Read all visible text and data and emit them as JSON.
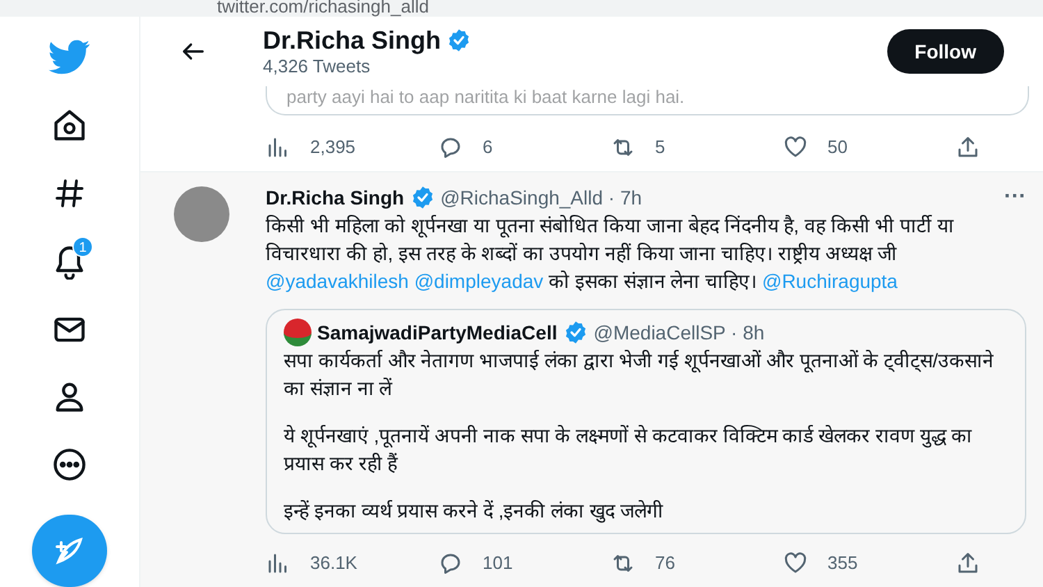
{
  "browser": {
    "url": "twitter.com/richasingh_alld"
  },
  "sidebar": {
    "items": [
      {
        "kind": "logo"
      },
      {
        "kind": "home"
      },
      {
        "kind": "explore"
      },
      {
        "kind": "notifications",
        "badge": "1"
      },
      {
        "kind": "messages"
      },
      {
        "kind": "profile"
      },
      {
        "kind": "more"
      }
    ],
    "compose": true
  },
  "header": {
    "name": "Dr.Richa Singh",
    "verified": true,
    "tweet_count": "4,326 Tweets",
    "follow_button": "Follow"
  },
  "previous_tweet": {
    "quoted_text": "party aayi hai to aap naritita ki baat karne lagi hai.",
    "stats": [
      {
        "kind": "views",
        "count": "2,395"
      },
      {
        "kind": "reply",
        "count": "6"
      },
      {
        "kind": "retweet",
        "count": "5"
      },
      {
        "kind": "like",
        "count": "50"
      },
      {
        "kind": "share"
      }
    ]
  },
  "tweet": {
    "author": "Dr.Richa Singh",
    "verified": true,
    "handle": "@RichaSingh_Alld · 7h",
    "menu": "···",
    "body": [
      {
        "kind": "text",
        "text": "किसी भी महिला को शूर्पनखा या पूतना संबोधित किया जाना बेहद निंदनीय है, वह किसी भी पार्टी या विचारधारा की हो, इस तरह के शब्दों का उपयोग नहीं किया जाना चाहिए। राष्ट्रीय अध्यक्ष जी "
      },
      {
        "kind": "mention",
        "text": "@yadavakhilesh"
      },
      {
        "kind": "mention",
        "text": "@dimpleyadav"
      },
      {
        "kind": "text",
        "text": " को इसका संज्ञान लेना चाहिए। "
      },
      {
        "kind": "mention",
        "text": "@Ruchiragupta"
      }
    ],
    "quote": {
      "author": "SamajwadiPartyMediaCell",
      "verified": true,
      "handle": "@MediaCellSP · 8h",
      "paragraphs": [
        "सपा कार्यकर्ता और नेतागण भाजपाई लंका द्वारा भेजी गई शूर्पनखाओं और पूतनाओं के ट्वीट्स/उकसाने का संज्ञान ना लें",
        "ये शूर्पनखाएं ,पूतनायें अपनी नाक सपा के लक्ष्मणों से कटवाकर विक्टिम कार्ड खेलकर रावण युद्ध का प्रयास कर रही हैं",
        "इन्हें इनका व्यर्थ प्रयास करने दें ,इनकी लंका खुद जलेगी"
      ]
    },
    "stats": [
      {
        "kind": "views",
        "count": "36.1K"
      },
      {
        "kind": "reply",
        "count": "101"
      },
      {
        "kind": "retweet",
        "count": "76"
      },
      {
        "kind": "like",
        "count": "355"
      },
      {
        "kind": "share"
      }
    ]
  }
}
